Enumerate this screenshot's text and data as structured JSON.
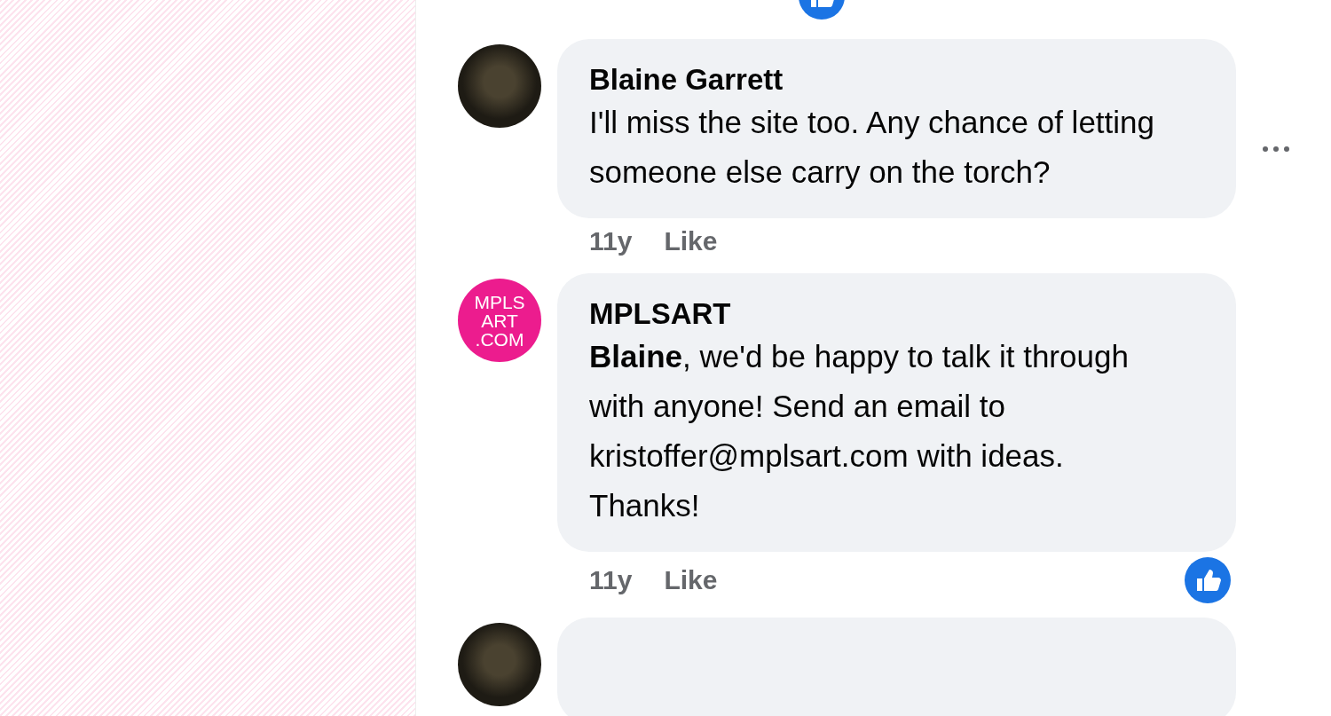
{
  "previous_comment": {
    "liked": true
  },
  "comments": [
    {
      "avatar": {
        "kind": "photo"
      },
      "name": "Blaine Garrett",
      "text": "I'll miss the site too. Any chance of letting someone else carry on the torch?",
      "time": "11y",
      "like_label": "Like",
      "liked": false,
      "show_menu": true
    },
    {
      "avatar": {
        "kind": "logo",
        "lines": [
          "MPLS",
          "ART",
          ".COM"
        ],
        "color": "#ec1c8e"
      },
      "name": "MPLSART",
      "text": "**Blaine**, we'd be happy to talk it through with anyone! Send an email to kristoffer@mplsart.com with ideas. Thanks!",
      "time": "11y",
      "like_label": "Like",
      "liked": true,
      "show_menu": false
    },
    {
      "avatar": {
        "kind": "photo"
      }
    }
  ]
}
